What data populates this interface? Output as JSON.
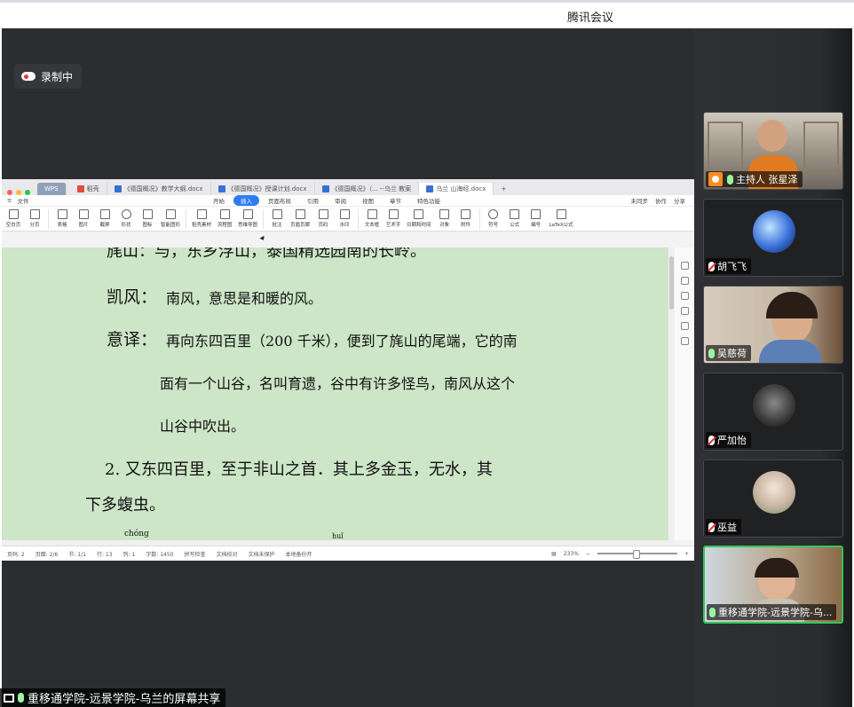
{
  "window": {
    "title": "腾讯会议"
  },
  "recording": {
    "label": "录制中"
  },
  "share_bar": {
    "text": "重移通学院-远景学院-乌兰的屏幕共享"
  },
  "participants": [
    {
      "name": "主持人 张星泽",
      "mic": "on",
      "video": "camera",
      "host": true
    },
    {
      "name": "胡飞飞",
      "mic": "muted",
      "video": "avatar"
    },
    {
      "name": "吴慈荷",
      "mic": "on",
      "video": "camera"
    },
    {
      "name": "严加怡",
      "mic": "muted",
      "video": "avatar"
    },
    {
      "name": "巫益",
      "mic": "muted",
      "video": "avatar"
    },
    {
      "name": "重移通学院-远景学院-乌...",
      "mic": "on",
      "video": "camera",
      "active": true
    }
  ],
  "wps": {
    "tabs": [
      {
        "label": "WPS"
      },
      {
        "label": "稻壳"
      },
      {
        "label": "《德国概况》教学大纲.docx"
      },
      {
        "label": "《德国概况》授课计划.docx"
      },
      {
        "label": "《德国概况》（... --乌兰 教案"
      },
      {
        "label": "乌兰 山海经.docx"
      }
    ],
    "menu": [
      "文件"
    ],
    "ribbon_tabs": [
      "开始",
      "插入",
      "页面布局",
      "引用",
      "审阅",
      "视图",
      "章节",
      "特色功能"
    ],
    "ribbon_tab_active": "插入",
    "ribbon_right": [
      "未同步",
      "协作",
      "分享"
    ],
    "ribbon_buttons": [
      "空白页",
      "分页",
      "表格",
      "图片",
      "截屏",
      "形状",
      "图标",
      "智能图形",
      "稻壳素材",
      "流程图",
      "思维导图",
      "批注",
      "页眉页脚",
      "页码",
      "水印",
      "文本框",
      "艺术字",
      "日期和时间",
      "对象",
      "附件",
      "符号",
      "公式",
      "编号",
      "LaTeX公式"
    ],
    "status": {
      "page": "页码: 2",
      "pages": "页面: 2/6",
      "section": "节: 1/1",
      "row": "行: 13",
      "col": "列: 1",
      "words": "字数: 1450",
      "spell": "拼写检查",
      "proof": "文档校对",
      "protect": "文档未保护",
      "backup": "本地备份开",
      "zoom": "233%"
    }
  },
  "document": {
    "line0": "旄山：与，东乡浮山，泰国精选园南的长岭。",
    "kaifeng_term": "凯风：",
    "kaifeng_def": "南风，意思是和暖的风。",
    "yiyi_term": "意译：",
    "yiyi_line1": "再向东四百里（200 千米），便到了旄山的尾端，它的南",
    "yiyi_line2": "面有一个山谷，名叫育遗，谷中有许多怪鸟，南风从这个",
    "yiyi_line3": "山谷中吹出。",
    "para2_line1": "2. 又东四百里，至于非山之首．其上多金玉，无水，其",
    "para2_line2": "下多蝮虫。",
    "pinyin_a": "chóng",
    "pinyin_b": "huǐ"
  },
  "colors": {
    "doc_bg": "#cde6c7",
    "accent": "#2f7cf6",
    "active_border": "#34c759"
  }
}
